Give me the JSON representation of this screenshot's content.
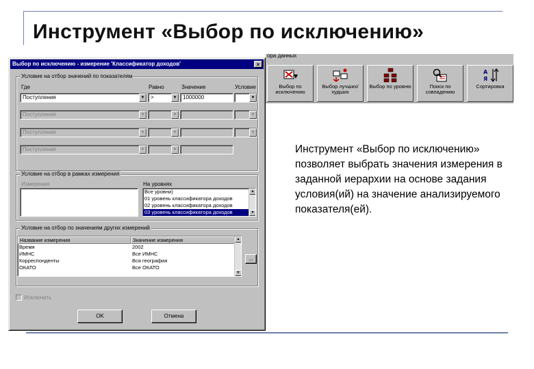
{
  "slide": {
    "title": "Инструмент «Выбор по исключению»",
    "description": "Инструмент «Выбор по исключению» позволяет выбрать значения измерения в заданной иерархии на основе задания условия(ий) на значение анализируемого показателя(ей)."
  },
  "toolbar": {
    "caption": "ора данных",
    "buttons": [
      {
        "label": "Выбор по исключению",
        "icon": "exclusion-select-icon"
      },
      {
        "label": "Выбор лучших/худших",
        "icon": "best-worst-select-icon"
      },
      {
        "label": "Выбор по уровню",
        "icon": "level-select-icon"
      },
      {
        "label": "Поиск по совпадению",
        "icon": "match-search-icon"
      },
      {
        "label": "Сортировка",
        "icon": "sort-icon"
      }
    ]
  },
  "dialog": {
    "title": "Выбор по исключению - измерение 'Классификатор доходов'",
    "close_label": "×",
    "group1": {
      "title": "Условие на отбор значений по показателям",
      "col_where": "Где",
      "col_equals": "Равно",
      "col_value": "Значение",
      "col_condition": "Условие",
      "rows": [
        {
          "where": "Поступления",
          "op": ">",
          "value": "1000000",
          "condition": ""
        },
        {
          "where": "Поступления",
          "op": "",
          "value": "",
          "condition": ""
        },
        {
          "where": "Поступления",
          "op": "",
          "value": "",
          "condition": ""
        },
        {
          "where": "Поступления",
          "op": "",
          "value": "",
          "condition": ""
        }
      ]
    },
    "group2": {
      "title": "Условие на отбор в рамках измерения",
      "label_measurement": "Измерения",
      "label_levels": "На уровнях",
      "levels": [
        "Все уровни)",
        "01 уровень классификатора доходов",
        "02 уровень классификатора доходов",
        "03 уровень классификатора доходов"
      ],
      "selected_level_index": 3
    },
    "group3": {
      "title": "Условие на отбор по значениям других измерений",
      "col_name": "Название измерения",
      "col_value": "Значение измерения",
      "rows": [
        {
          "name": "Время",
          "value": "2002"
        },
        {
          "name": "ИМНС",
          "value": "Все ИМНС"
        },
        {
          "name": "Корреспонденты",
          "value": "Вся география"
        },
        {
          "name": "ОКАТО",
          "value": "Все ОКАТО"
        }
      ],
      "browse_label": "..."
    },
    "exclude_checkbox_label": "Исключить",
    "ok_label": "OK",
    "cancel_label": "Отмена"
  }
}
